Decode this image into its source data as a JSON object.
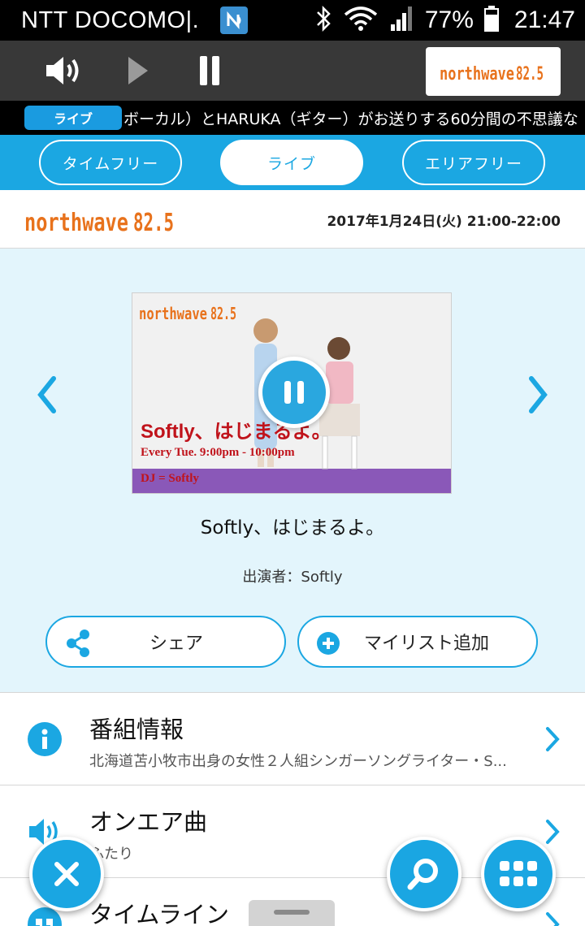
{
  "status_bar": {
    "carrier": "NTT DOCOMO|.",
    "battery": "77%",
    "time": "21:47"
  },
  "player": {
    "station_logo_text": "northwave",
    "station_logo_freq": "82.5"
  },
  "ticker": {
    "badge": "ライブ",
    "text": "ボーカル）とHARUKA（ギター）がお送りする60分間の不思議な"
  },
  "tabs": [
    {
      "label": "タイムフリー",
      "active": false
    },
    {
      "label": "ライブ",
      "active": true
    },
    {
      "label": "エリアフリー",
      "active": false
    }
  ],
  "station": {
    "logo_text": "northwave",
    "logo_freq": "82.5",
    "datetime": "2017年1月24日(火) 21:00-22:00"
  },
  "program": {
    "image_title": "Softly、はじまるよ。",
    "image_schedule": "Every Tue.  9:00pm - 10:00pm",
    "image_dj": "DJ = Softly",
    "title": "Softly、はじまるよ。",
    "performer": "出演者：Softly",
    "share_label": "シェア",
    "mylist_label": "マイリスト追加"
  },
  "info_items": [
    {
      "title": "番組情報",
      "subtitle": "北海道苫小牧市出身の女性２人組シンガーソングライター・S..."
    },
    {
      "title": "オンエア曲",
      "subtitle": "ふたり"
    },
    {
      "title": "タイムライン",
      "subtitle": ""
    }
  ],
  "colors": {
    "accent": "#1ba7e2",
    "panel": "#e3f5fc",
    "logo_orange": "#e8721c",
    "image_title_red": "#c0131b"
  }
}
